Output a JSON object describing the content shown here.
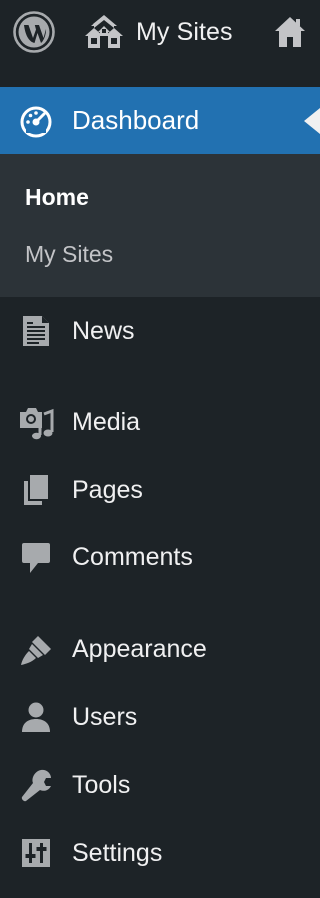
{
  "adminbar": {
    "mysites_label": "My Sites"
  },
  "menu": {
    "dashboard": {
      "label": "Dashboard"
    },
    "submenu": [
      {
        "label": "Home",
        "current": true
      },
      {
        "label": "My Sites",
        "current": false
      }
    ],
    "items": [
      {
        "label": "News",
        "icon": "news-icon"
      },
      {
        "label": "Media",
        "icon": "media-icon"
      },
      {
        "label": "Pages",
        "icon": "pages-icon"
      },
      {
        "label": "Comments",
        "icon": "comments-icon"
      },
      {
        "label": "Appearance",
        "icon": "appearance-icon"
      },
      {
        "label": "Users",
        "icon": "users-icon"
      },
      {
        "label": "Tools",
        "icon": "tools-icon"
      },
      {
        "label": "Settings",
        "icon": "settings-icon"
      }
    ]
  },
  "colors": {
    "background": "#1d2327",
    "submenu_background": "#2c3338",
    "accent": "#2271b1",
    "text": "#f0f0f1",
    "icon": "#a7aaad"
  }
}
